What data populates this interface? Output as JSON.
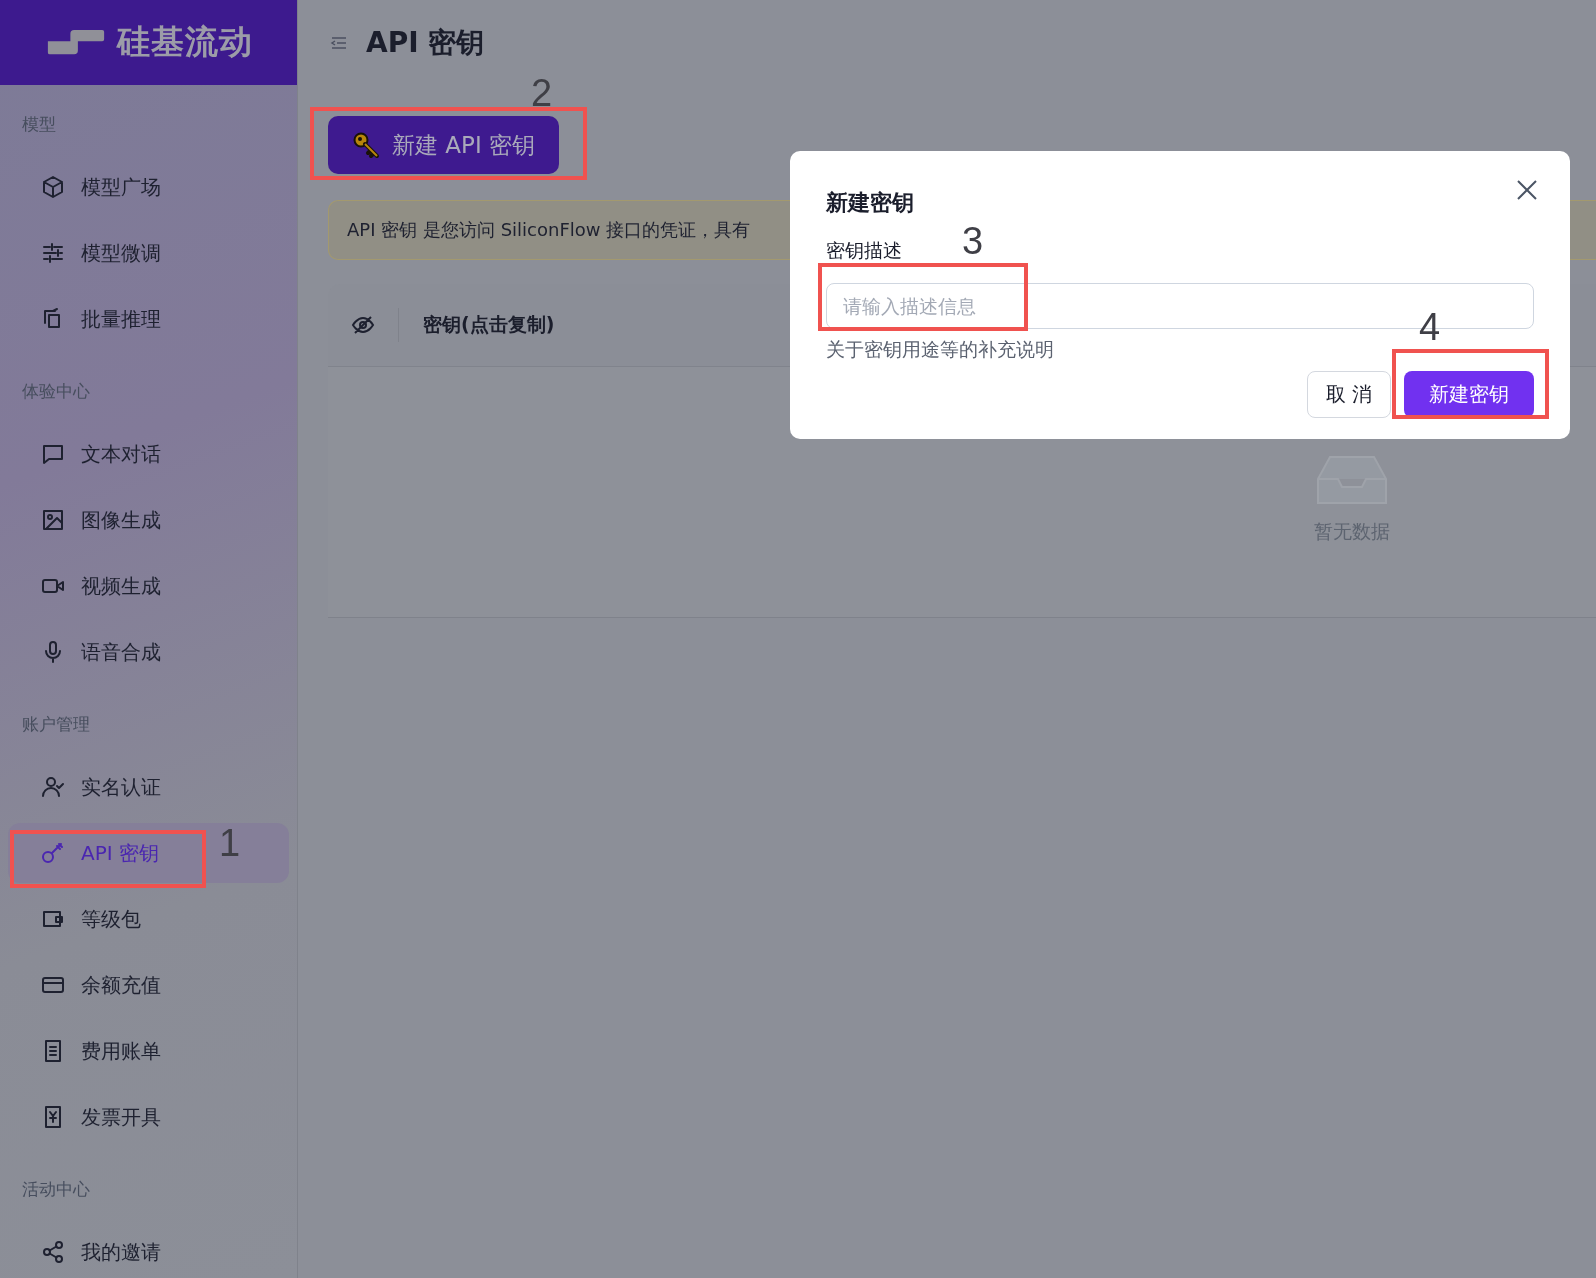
{
  "logo": {
    "text": "硅基流动"
  },
  "sidebar": {
    "sections": [
      {
        "title": "模型",
        "items": [
          {
            "label": "模型广场",
            "selected": false
          },
          {
            "label": "模型微调",
            "selected": false
          },
          {
            "label": "批量推理",
            "selected": false
          }
        ]
      },
      {
        "title": "体验中心",
        "items": [
          {
            "label": "文本对话",
            "selected": false
          },
          {
            "label": "图像生成",
            "selected": false
          },
          {
            "label": "视频生成",
            "selected": false
          },
          {
            "label": "语音合成",
            "selected": false
          }
        ]
      },
      {
        "title": "账户管理",
        "items": [
          {
            "label": "实名认证",
            "selected": false
          },
          {
            "label": "API 密钥",
            "selected": true
          },
          {
            "label": "等级包",
            "selected": false
          },
          {
            "label": "余额充值",
            "selected": false
          },
          {
            "label": "费用账单",
            "selected": false
          },
          {
            "label": "发票开具",
            "selected": false
          }
        ]
      },
      {
        "title": "活动中心",
        "items": [
          {
            "label": "我的邀请",
            "selected": false
          }
        ]
      }
    ]
  },
  "page": {
    "title": "API 密钥",
    "create_button": "新建 API 密钥",
    "notice": "API 密钥 是您访问 SiliconFlow 接口的凭证，具有",
    "table": {
      "columns": [
        "密钥(点击复制)"
      ],
      "empty_text": "暂无数据"
    }
  },
  "dialog": {
    "title": "新建密钥",
    "field_label": "密钥描述",
    "placeholder": "请输入描述信息",
    "help_text": "关于密钥用途等的补充说明",
    "buttons": [
      {
        "label": "取 消",
        "kind": "secondary"
      },
      {
        "label": "新建密钥",
        "kind": "primary"
      }
    ]
  },
  "annotations": [
    {
      "label": "1"
    },
    {
      "label": "2"
    },
    {
      "label": "3"
    },
    {
      "label": "4"
    }
  ]
}
